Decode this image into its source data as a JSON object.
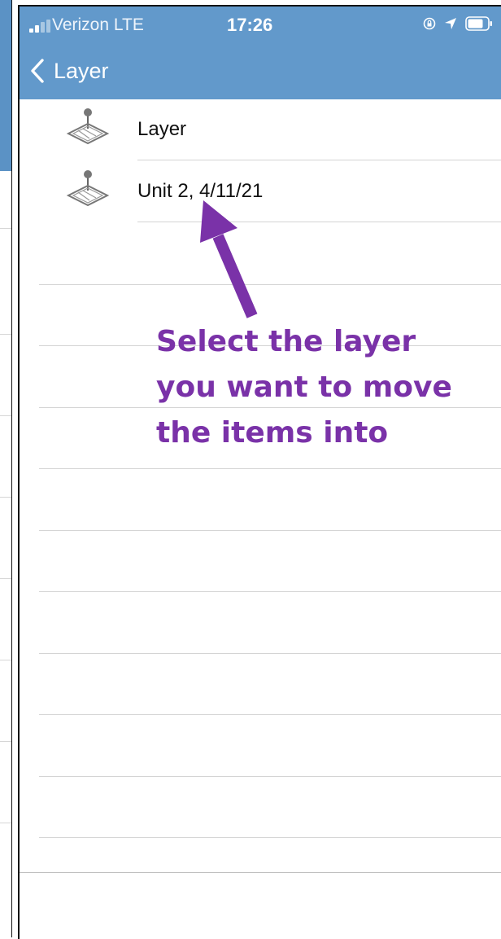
{
  "status_bar": {
    "carrier": "Verizon  LTE",
    "time": "17:26"
  },
  "nav": {
    "back_label": "Layer"
  },
  "layers": [
    {
      "label": "Layer",
      "icon": "map-layer-icon"
    },
    {
      "label": "Unit 2, 4/11/21",
      "icon": "map-layer-icon"
    }
  ],
  "annotation": {
    "lines": [
      "Select the layer",
      "you want to move",
      "the items into"
    ],
    "color": "#7a32a8"
  },
  "colors": {
    "nav_blue": "#6299cb",
    "separator": "#d4d4d4"
  }
}
